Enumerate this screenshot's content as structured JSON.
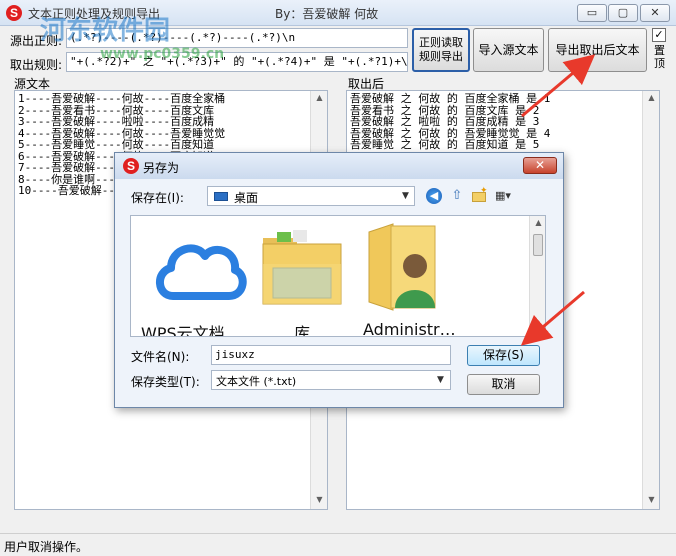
{
  "window": {
    "title": "文本正则处理及规则导出",
    "byline": "By：吾爱破解  何故",
    "controls": {
      "minimize": "▭",
      "maximize": "▢",
      "close": "✕"
    }
  },
  "watermark": {
    "text": "河东软件园",
    "url": "www.pc0359.cn"
  },
  "form": {
    "src_regex_label": "源出正则:",
    "src_regex_value": "(.*?)----(.*?)----(.*?)----(.*?)\\n",
    "out_regex_label": "取出规则:",
    "out_regex_value": "\"+(.*?2)+\" 之 \"+(.*?3)+\" 的 \"+(.*?4)+\" 是 \"+(.*?1)+\\n",
    "btn_regex_read": "正则读取\n规则导出",
    "btn_import": "导入源文本",
    "btn_export": "导出取出后文本",
    "pin_label": "置顶",
    "pin_checked": true
  },
  "panels": {
    "source_label": "源文本",
    "result_label": "取出后",
    "source_lines": [
      "1----吾爱破解----何故----百度全家桶",
      "2----吾爱看书----何故----百度文库",
      "3----吾爱破解----啦啦----百度成精",
      "4----吾爱破解----何故----吾爱睡觉觉",
      "5----吾爱睡觉----何故----百度知道",
      "6----吾爱破解----何故----百度知道",
      "7----吾爱破解----何故----百度知道",
      "8----你是谁啊----何故----百度知道",
      "10----吾爱破解----何故----百度知道"
    ],
    "result_lines": [
      "吾爱破解 之 何故 的 百度全家桶 是 1",
      "吾爱看书 之 何故 的 百度文库 是 2",
      "吾爱破解 之 啦啦 的 百度成精 是 3",
      "吾爱破解 之 何故 的 吾爱睡觉觉 是 4",
      "吾爱睡觉 之 何故 的 百度知道 是 5",
      "",
      "                              7",
      "                          5 是 8"
    ]
  },
  "status": {
    "text": "用户取消操作。"
  },
  "dialog": {
    "title": "另存为",
    "close": "✕",
    "save_in_label": "保存在(I):",
    "save_in_value": "桌面",
    "items": [
      {
        "label": "WPS云文档",
        "icon": "wps-cloud-icon"
      },
      {
        "label": "库",
        "icon": "library-folder-icon"
      },
      {
        "label": "Administr…",
        "icon": "user-folder-icon"
      }
    ],
    "filename_label": "文件名(N):",
    "filename_value": "jisuxz",
    "filetype_label": "保存类型(T):",
    "filetype_value": "文本文件 (*.txt)",
    "save_button": "保存(S)",
    "cancel_button": "取消"
  },
  "colors": {
    "accent_red": "#e8392b",
    "cloud_blue": "#2b7fe0",
    "folder_yellow": "#f3cf66"
  }
}
